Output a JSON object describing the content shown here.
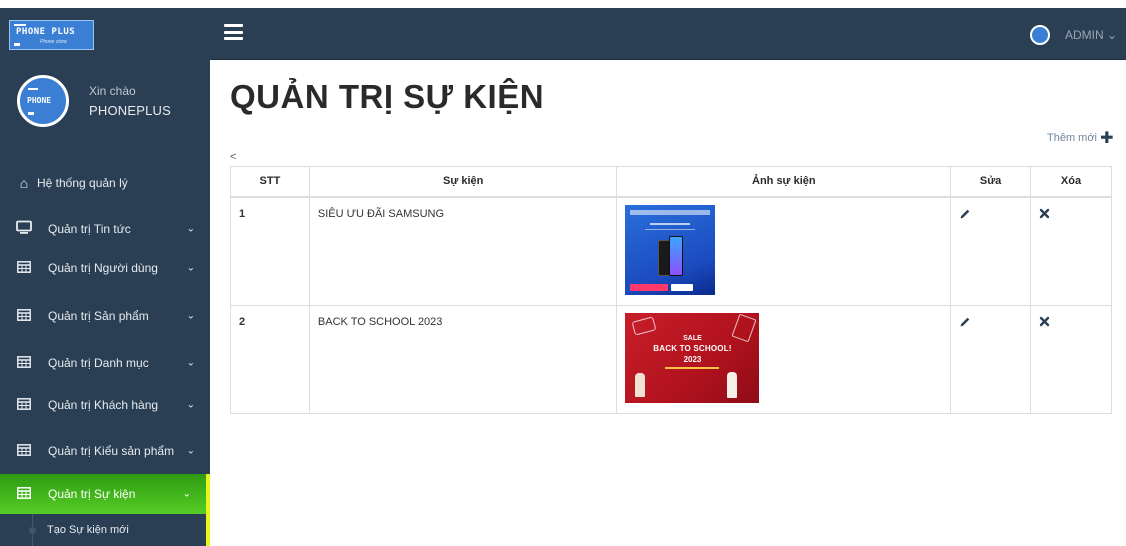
{
  "brand": {
    "logo_text": "PHONE PLUS",
    "logo_sub": "Phone store"
  },
  "profile": {
    "greeting": "Xin chào",
    "name": "PHONEPLUS",
    "avatar_text": "PHONE"
  },
  "topnav": {
    "user_label": "ADMIN ⌄"
  },
  "sidebar": {
    "home": {
      "label": "Hệ thống quản lý",
      "icon": "home-icon"
    },
    "items": [
      {
        "label": "Quản trị Tin tức",
        "icon": "monitor-icon",
        "active": false
      },
      {
        "label": "Quản trị Người dùng",
        "icon": "table-icon",
        "active": false
      },
      {
        "label": "Quản trị Sản phẩm",
        "icon": "table-icon",
        "active": false
      },
      {
        "label": "Quản trị Danh mục",
        "icon": "table-icon",
        "active": false
      },
      {
        "label": "Quản trị Khách hàng",
        "icon": "table-icon",
        "active": false
      },
      {
        "label": "Quản trị Kiểu sản phẩm",
        "icon": "table-icon",
        "active": false
      },
      {
        "label": "Quản trị Sự kiện",
        "icon": "table-icon",
        "active": true
      }
    ],
    "submenu": {
      "label": "Tạo Sự kiện mới"
    }
  },
  "page": {
    "title": "QUẢN TRỊ SỰ KIỆN",
    "add_new": "Thêm mới",
    "back": "<"
  },
  "table": {
    "headers": {
      "stt": "STT",
      "event": "Sự kiện",
      "image": "Ảnh sự kiện",
      "edit": "Sửa",
      "delete": "Xóa"
    },
    "rows": [
      {
        "stt": "1",
        "name": "SIÊU ƯU ĐÃI SAMSUNG"
      },
      {
        "stt": "2",
        "name": "BACK TO SCHOOL 2023",
        "image_sale": "SALE",
        "image_title": "BACK TO SCHOOL!",
        "image_year": "2023"
      }
    ]
  },
  "colors": {
    "sidebar_bg": "#2a3f54",
    "active_green": "#3fb21a",
    "active_border": "#e8f51a",
    "brand_blue": "#3b7fd4"
  }
}
